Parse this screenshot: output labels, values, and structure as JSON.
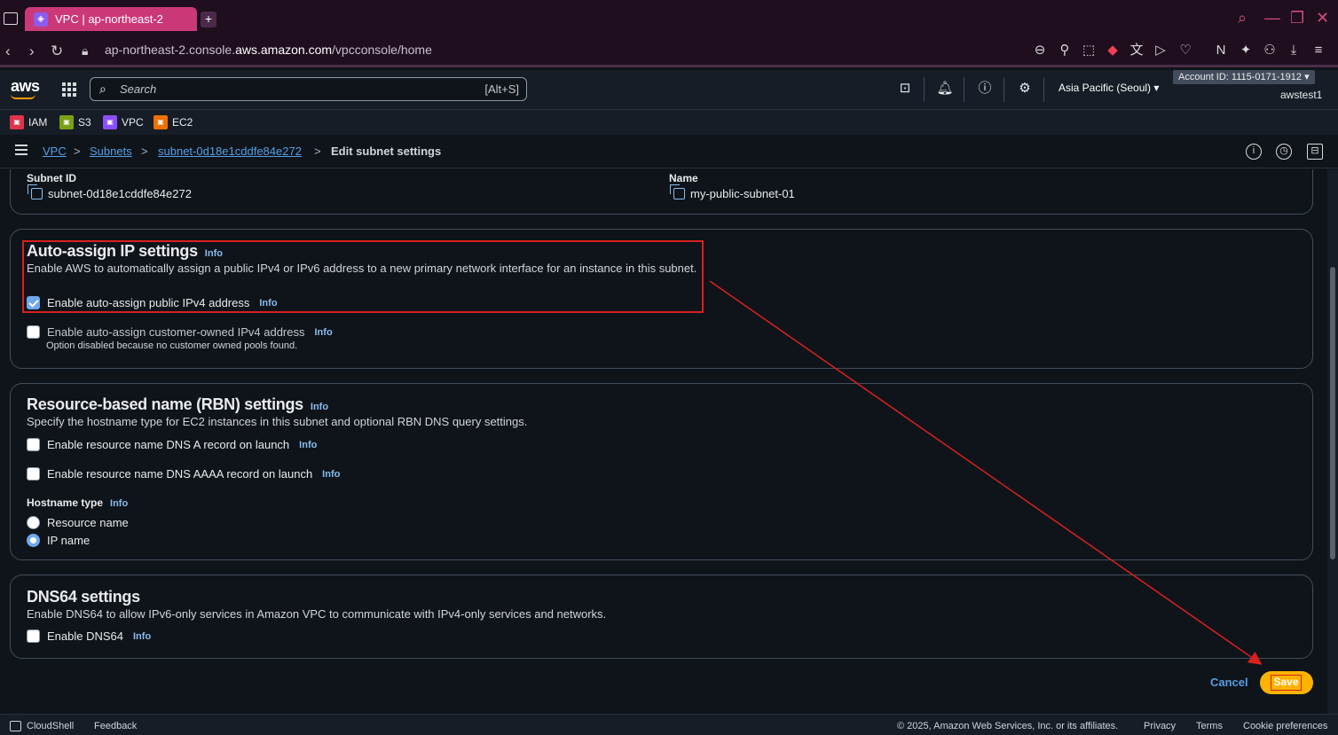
{
  "browser": {
    "tab_title": "VPC | ap-northeast-2",
    "new_tab": "+",
    "url_prefix": "ap-northeast-2.console.",
    "url_domain": "aws.amazon.com",
    "url_path": "/vpcconsole/home"
  },
  "aws_header": {
    "logo": "aws",
    "search_placeholder": "Search",
    "search_shortcut": "[Alt+S]",
    "region": "Asia Pacific (Seoul) ▾",
    "account": "Account ID: 1115-0171-1912 ▾",
    "user": "awstest1"
  },
  "favorites": [
    {
      "label": "IAM",
      "color": "#dd344c"
    },
    {
      "label": "S3",
      "color": "#7aa116"
    },
    {
      "label": "VPC",
      "color": "#8c4fff"
    },
    {
      "label": "EC2",
      "color": "#ed7100"
    }
  ],
  "breadcrumb": {
    "items": [
      "VPC",
      "Subnets",
      "subnet-0d18e1cddfe84e272"
    ],
    "current": "Edit subnet settings",
    "sep": ">"
  },
  "subnet_info": {
    "id_label": "Subnet ID",
    "id_value": "subnet-0d18e1cddfe84e272",
    "name_label": "Name",
    "name_value": "my-public-subnet-01"
  },
  "auto_assign": {
    "title": "Auto-assign IP settings",
    "info": "Info",
    "description": "Enable AWS to automatically assign a public IPv4 or IPv6 address to a new primary network interface for an instance in this subnet.",
    "opt_public_ipv4": "Enable auto-assign public IPv4 address",
    "opt_public_ipv4_checked": true,
    "opt_customer_ipv4": "Enable auto-assign customer-owned IPv4 address",
    "opt_customer_ipv4_note": "Option disabled because no customer owned pools found."
  },
  "rbn": {
    "title": "Resource-based name (RBN) settings",
    "info": "Info",
    "description": "Specify the hostname type for EC2 instances in this subnet and optional RBN DNS query settings.",
    "opt_dns_a": "Enable resource name DNS A record on launch",
    "opt_dns_aaaa": "Enable resource name DNS AAAA record on launch",
    "hostname_label": "Hostname type",
    "radio_resource": "Resource name",
    "radio_ip": "IP name",
    "selected": "IP name"
  },
  "dns64": {
    "title": "DNS64 settings",
    "description": "Enable DNS64 to allow IPv6-only services in Amazon VPC to communicate with IPv4-only services and networks.",
    "opt_enable": "Enable DNS64",
    "info": "Info"
  },
  "actions": {
    "cancel": "Cancel",
    "save": "Save"
  },
  "footer": {
    "cloudshell": "CloudShell",
    "feedback": "Feedback",
    "copyright": "© 2025, Amazon Web Services, Inc. or its affiliates.",
    "privacy": "Privacy",
    "terms": "Terms",
    "cookies": "Cookie preferences"
  },
  "colors": {
    "annotation_red": "#d8201f",
    "save_orange": "#ffb300",
    "link_blue": "#539fe5"
  }
}
